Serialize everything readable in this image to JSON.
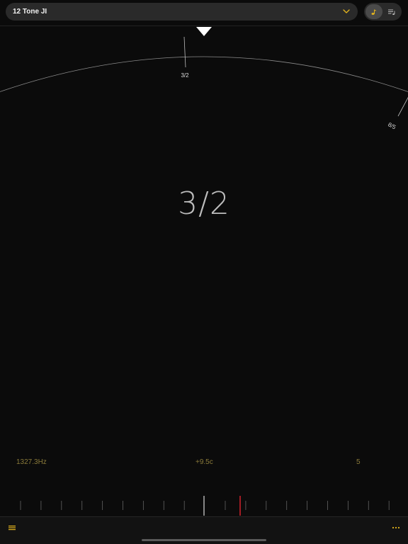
{
  "header": {
    "scale_name": "12 Tone JI",
    "dropdown_icon": "chevron-down-icon",
    "mode_buttons": [
      {
        "icon": "music-note-icon",
        "selected": true
      },
      {
        "icon": "list-music-icon",
        "selected": false
      }
    ]
  },
  "dial": {
    "labels": [
      "3/2",
      "8/5"
    ]
  },
  "readout": {
    "ratio": "3/2",
    "frequency": "1327.3Hz",
    "cents": "+9.5c",
    "octave": "5"
  },
  "colors": {
    "accent": "#e0b21e",
    "background": "#0b0b0b",
    "needle_red": "#c8202a",
    "info_text": "#8a7a3a"
  },
  "footer": {
    "menu_icon": "hamburger-menu-icon",
    "more_icon": "more-dots-icon"
  }
}
